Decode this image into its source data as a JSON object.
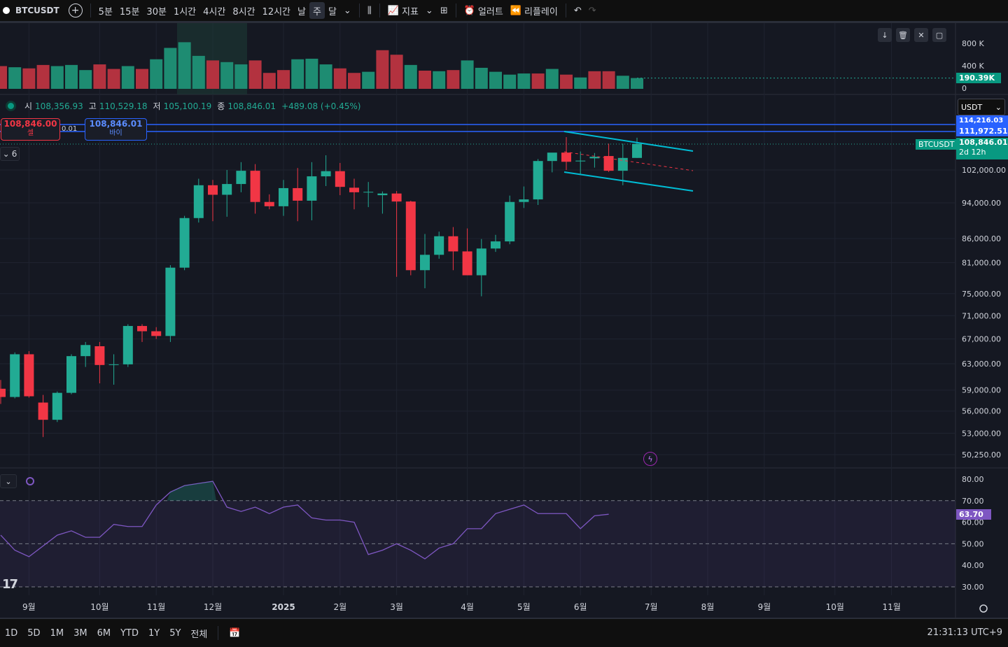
{
  "toolbar": {
    "symbol": "BTCUSDT",
    "intervals": [
      "5분",
      "15분",
      "30분",
      "1시간",
      "4시간",
      "8시간",
      "12시간",
      "날",
      "주",
      "달"
    ],
    "active_interval": "주",
    "indicators_label": "지표",
    "alerts_label": "얼러트",
    "replay_label": "리플레이"
  },
  "ohlc": {
    "open_label": "시",
    "open": "108,356.93",
    "high_label": "고",
    "high": "110,529.18",
    "low_label": "저",
    "low": "105,100.19",
    "close_label": "종",
    "close": "108,846.01",
    "change": "+489.08 (+0.45%)"
  },
  "trade": {
    "sell_price": "108,846.00",
    "sell_label": "셀",
    "buy_price": "108,846.01",
    "buy_label": "바이",
    "spread": "0.01"
  },
  "collapse_count": "6",
  "currency": "USDT",
  "price_tags": {
    "top_line": "114,216.03",
    "line2": "111,972.51",
    "last_price": "108,846.01",
    "countdown": "2d 12h",
    "symbol_tag": "BTCUSDT",
    "volume_tag": "190.39K",
    "rsi_tag": "63.70"
  },
  "bottombar": {
    "ranges": [
      "1D",
      "5D",
      "1M",
      "3M",
      "6M",
      "YTD",
      "1Y",
      "5Y",
      "전체"
    ],
    "time": "21:31:13 UTC+9"
  },
  "colors": {
    "up": "#22ab94",
    "down": "#f23645",
    "line": "#2962ff",
    "rsi": "#7e57c2",
    "channel": "#00bcd4",
    "bg": "#151822"
  },
  "chart_data": {
    "type": "candlestick",
    "price_scale": "log",
    "price_ticks": [
      102000,
      94000,
      86000,
      81000,
      75000,
      71000,
      67000,
      63000,
      59000,
      56000,
      53000,
      50250
    ],
    "price_tick_labels": [
      "102,000.00",
      "94,000.00",
      "86,000.00",
      "81,000.00",
      "75,000.00",
      "71,000.00",
      "67,000.00",
      "63,000.00",
      "59,000.00",
      "56,000.00",
      "53,000.00",
      "50,250.00"
    ],
    "volume_ticks": [
      "800 K",
      "400 K",
      "0"
    ],
    "rsi_ticks": [
      "80.00",
      "70.00",
      "60.00",
      "50.00",
      "40.00",
      "30.00"
    ],
    "x_labels": [
      {
        "label": "9월",
        "i": 2
      },
      {
        "label": "10월",
        "i": 7
      },
      {
        "label": "11월",
        "i": 11
      },
      {
        "label": "12월",
        "i": 15
      },
      {
        "label": "2025",
        "i": 20
      },
      {
        "label": "2월",
        "i": 24
      },
      {
        "label": "3월",
        "i": 28
      },
      {
        "label": "4월",
        "i": 33
      },
      {
        "label": "5월",
        "i": 37
      },
      {
        "label": "6월",
        "i": 41
      },
      {
        "label": "7월",
        "i": 46
      },
      {
        "label": "8월",
        "i": 50
      },
      {
        "label": "9월",
        "i": 54
      },
      {
        "label": "10월",
        "i": 59
      },
      {
        "label": "11월",
        "i": 63
      }
    ],
    "candles": [
      [
        59200,
        60500,
        57000,
        58000
      ],
      [
        58000,
        64800,
        57800,
        64500
      ],
      [
        64500,
        65000,
        57900,
        58100
      ],
      [
        57200,
        58300,
        52500,
        54800
      ],
      [
        54800,
        58800,
        54500,
        58600
      ],
      [
        58600,
        64500,
        58400,
        64200
      ],
      [
        64200,
        66500,
        62500,
        66000
      ],
      [
        65800,
        66500,
        60000,
        62800
      ],
      [
        62800,
        64500,
        59800,
        62900
      ],
      [
        62900,
        69500,
        62500,
        69200
      ],
      [
        69200,
        69500,
        66500,
        68300
      ],
      [
        68300,
        69000,
        67000,
        67500
      ],
      [
        67500,
        80500,
        66500,
        80000
      ],
      [
        80000,
        91000,
        79500,
        90500
      ],
      [
        90500,
        99800,
        89500,
        98200
      ],
      [
        98200,
        99500,
        89800,
        95900
      ],
      [
        95900,
        102000,
        90800,
        98500
      ],
      [
        98500,
        104000,
        96500,
        101800
      ],
      [
        101800,
        103500,
        91500,
        94200
      ],
      [
        94200,
        96000,
        92500,
        93200
      ],
      [
        93200,
        99500,
        91000,
        97500
      ],
      [
        97500,
        102500,
        89800,
        94500
      ],
      [
        94500,
        104000,
        90000,
        100400
      ],
      [
        100400,
        105800,
        98000,
        101700
      ],
      [
        101700,
        103800,
        95800,
        97800
      ],
      [
        97600,
        99800,
        92500,
        96500
      ],
      [
        96500,
        99000,
        93000,
        96600
      ],
      [
        95800,
        96700,
        91500,
        96200
      ],
      [
        96200,
        96800,
        78200,
        94300
      ],
      [
        94300,
        94500,
        78500,
        79500
      ],
      [
        79500,
        87000,
        76000,
        82600
      ],
      [
        82600,
        87500,
        81800,
        86500
      ],
      [
        86500,
        88500,
        79500,
        83300
      ],
      [
        83300,
        88200,
        78500,
        78500
      ],
      [
        78500,
        85900,
        74500,
        83900
      ],
      [
        83900,
        86800,
        83200,
        85400
      ],
      [
        85400,
        95700,
        84800,
        94200
      ],
      [
        94200,
        97900,
        92800,
        94800
      ],
      [
        94800,
        104800,
        93500,
        104300
      ],
      [
        104300,
        105800,
        101400,
        106500
      ],
      [
        106500,
        110700,
        102000,
        104100
      ],
      [
        104200,
        106800,
        100800,
        104400
      ],
      [
        105000,
        106400,
        102600,
        105400
      ],
      [
        105600,
        108900,
        101500,
        101800
      ],
      [
        101800,
        108900,
        98200,
        105100
      ],
      [
        105100,
        110530,
        105100,
        108846
      ]
    ],
    "volumes": [
      {
        "v": 400,
        "up": false
      },
      {
        "v": 380,
        "up": true
      },
      {
        "v": 360,
        "up": false
      },
      {
        "v": 420,
        "up": false
      },
      {
        "v": 400,
        "up": true
      },
      {
        "v": 420,
        "up": true
      },
      {
        "v": 330,
        "up": true
      },
      {
        "v": 430,
        "up": false
      },
      {
        "v": 350,
        "up": false
      },
      {
        "v": 400,
        "up": true
      },
      {
        "v": 350,
        "up": false
      },
      {
        "v": 520,
        "up": true
      },
      {
        "v": 720,
        "up": true
      },
      {
        "v": 820,
        "up": true
      },
      {
        "v": 580,
        "up": true
      },
      {
        "v": 500,
        "up": false
      },
      {
        "v": 470,
        "up": true
      },
      {
        "v": 430,
        "up": true
      },
      {
        "v": 500,
        "up": false
      },
      {
        "v": 280,
        "up": false
      },
      {
        "v": 330,
        "up": false
      },
      {
        "v": 520,
        "up": true
      },
      {
        "v": 530,
        "up": true
      },
      {
        "v": 430,
        "up": true
      },
      {
        "v": 360,
        "up": false
      },
      {
        "v": 280,
        "up": false
      },
      {
        "v": 300,
        "up": true
      },
      {
        "v": 680,
        "up": false
      },
      {
        "v": 600,
        "up": false
      },
      {
        "v": 420,
        "up": true
      },
      {
        "v": 320,
        "up": false
      },
      {
        "v": 310,
        "up": true
      },
      {
        "v": 330,
        "up": false
      },
      {
        "v": 500,
        "up": true
      },
      {
        "v": 370,
        "up": true
      },
      {
        "v": 300,
        "up": true
      },
      {
        "v": 250,
        "up": true
      },
      {
        "v": 270,
        "up": true
      },
      {
        "v": 270,
        "up": false
      },
      {
        "v": 350,
        "up": true
      },
      {
        "v": 250,
        "up": false
      },
      {
        "v": 200,
        "up": true
      },
      {
        "v": 310,
        "up": false
      },
      {
        "v": 310,
        "up": false
      },
      {
        "v": 230,
        "up": true
      },
      {
        "v": 190,
        "up": true
      }
    ],
    "rsi": [
      54,
      47,
      44,
      49,
      54,
      56,
      53,
      53,
      59,
      58,
      58,
      68,
      74,
      77,
      78,
      79,
      67,
      65,
      67,
      64,
      67,
      68,
      62,
      61,
      61,
      60,
      45,
      47,
      50,
      47,
      43,
      48,
      50,
      57,
      57,
      64,
      66,
      68,
      64,
      64,
      64,
      57,
      63,
      63.7
    ]
  }
}
